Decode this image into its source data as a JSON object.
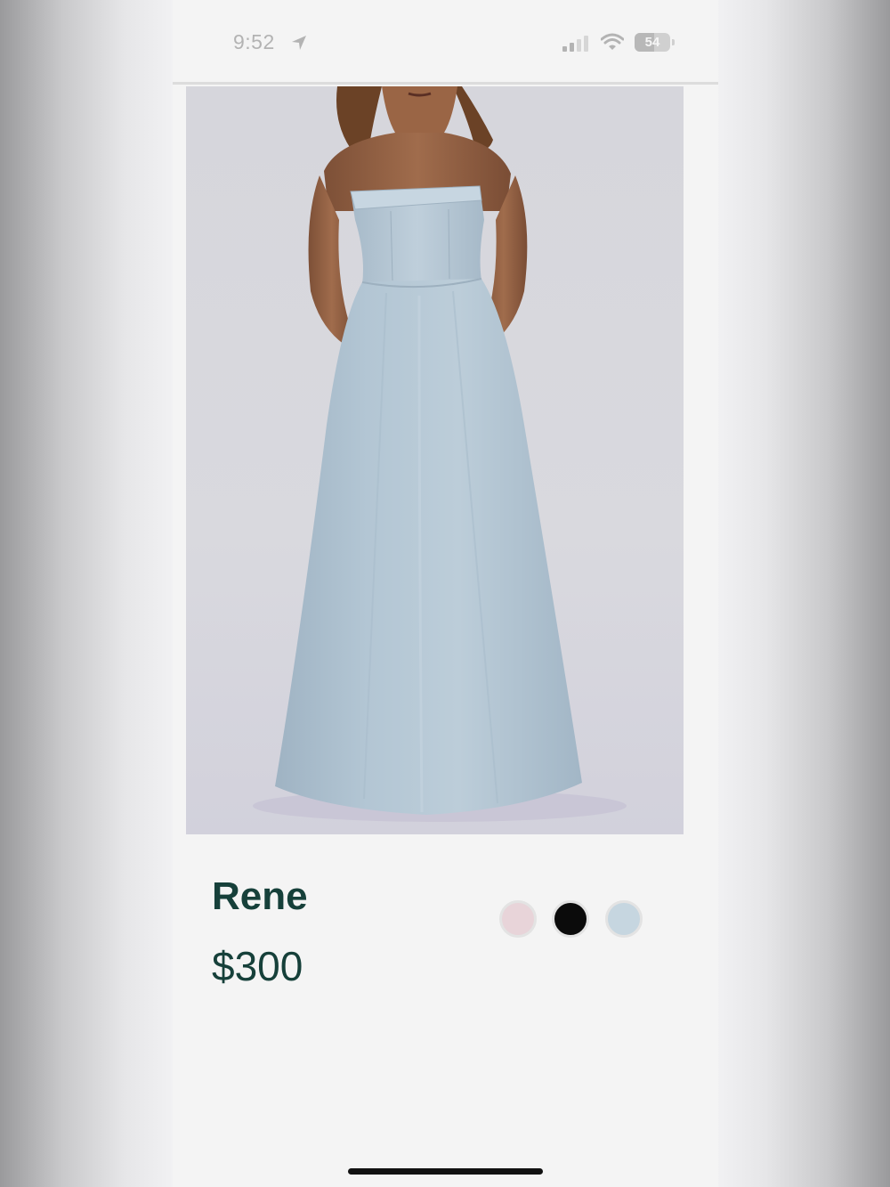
{
  "status_bar": {
    "time": "9:52",
    "battery": "54",
    "battery_level_percent": 54,
    "icons": [
      "location-arrow-icon",
      "cellular-signal-icon",
      "wifi-icon",
      "battery-icon"
    ]
  },
  "product": {
    "image": "strapless-light-blue-gown-photo",
    "name": "Rene",
    "price": "$300",
    "color_swatches": [
      {
        "name": "blush",
        "color": "#e8d4d9"
      },
      {
        "name": "black",
        "color": "#0b0b0b"
      },
      {
        "name": "light-blue",
        "color": "#c6d6e0"
      }
    ]
  }
}
